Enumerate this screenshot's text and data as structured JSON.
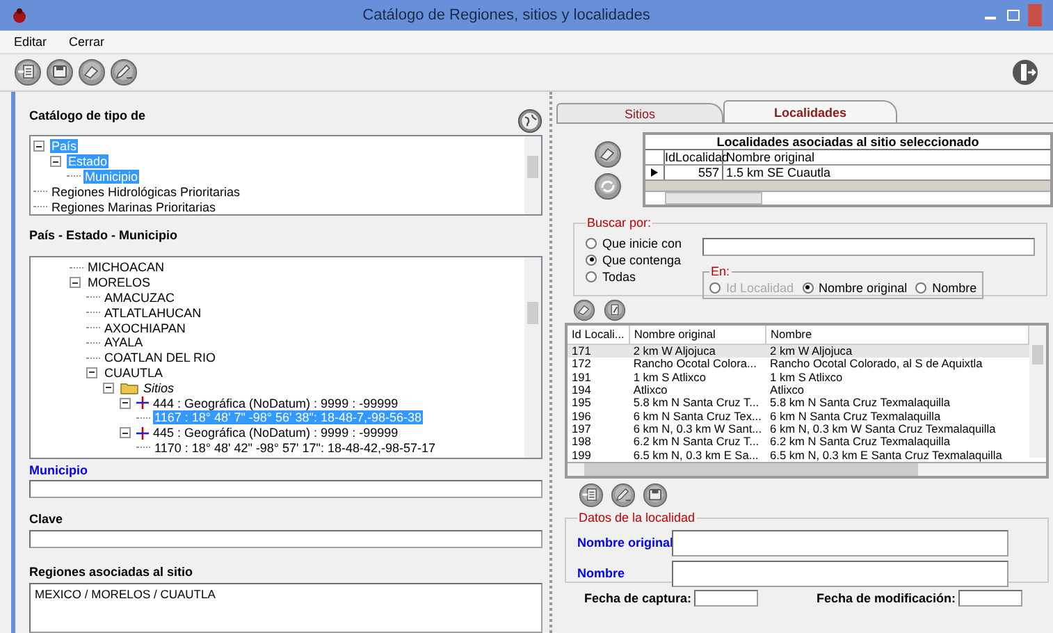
{
  "window": {
    "title": "Catálogo de Regiones, sitios y localidades"
  },
  "menu": [
    "Editar",
    "Cerrar"
  ],
  "region_types": {
    "title": "Catálogo de tipo de",
    "items": [
      {
        "label": "País",
        "selected": true,
        "expanded": true,
        "children": [
          {
            "label": "Estado",
            "selected": true,
            "expanded": true,
            "children": [
              {
                "label": "Municipio",
                "selected": true
              }
            ]
          }
        ]
      },
      {
        "label": "Regiones Hidrológicas Prioritarias",
        "selected": false
      },
      {
        "label": "Regiones Marinas Prioritarias",
        "selected": false
      }
    ]
  },
  "regions": {
    "title": "País - Estado - Municipio",
    "items": [
      {
        "label": "MICHOACAN",
        "selected": false
      },
      {
        "label": "MORELOS",
        "selected": false,
        "expanded": true,
        "children": [
          {
            "label": "AMACUZAC",
            "selected": false
          },
          {
            "label": "ATLATLAHUCAN",
            "selected": false
          },
          {
            "label": "AXOCHIAPAN",
            "selected": false
          },
          {
            "label": "AYALA",
            "selected": false
          },
          {
            "label": "COATLAN DEL RIO",
            "selected": false
          },
          {
            "label": "CUAUTLA",
            "selected": false,
            "expanded": true,
            "children": [
              {
                "label": "Sitios",
                "kind": "folder",
                "selected": false,
                "expanded": true,
                "children": [
                  {
                    "label": "444 : Geográfica (NoDatum) : 9999 : -99999",
                    "kind": "site",
                    "selected": false,
                    "expanded": true,
                    "children": [
                      {
                        "label": "1167 : 18° 48' 7\" -98° 56' 38\": 18-48-7,-98-56-38",
                        "selected": true
                      }
                    ]
                  },
                  {
                    "label": "445 : Geográfica (NoDatum) : 9999 : -99999",
                    "kind": "site",
                    "selected": false,
                    "expanded": true,
                    "children": [
                      {
                        "label": "1170 : 18° 48' 42\" -98° 57' 17\": 18-48-42,-98-57-17",
                        "selected": false
                      }
                    ]
                  }
                ]
              }
            ]
          }
        ]
      }
    ]
  },
  "municipio": {
    "label": "Municipio"
  },
  "clave": {
    "label": "Clave"
  },
  "associated_regions": {
    "label": "Regiones asociadas al sitio",
    "value": "MEXICO / MORELOS / CUAUTLA"
  },
  "tabs": [
    {
      "label": "Sitios",
      "selected": false
    },
    {
      "label": "Localidades",
      "selected": true
    }
  ],
  "linked_localities": {
    "title": "Localidades asociadas al sitio seleccionado",
    "columns": [
      "IdLocalidad",
      "Nombre original"
    ],
    "rows": [
      {
        "cells": [
          "557",
          "1.5 km SE Cuautla"
        ],
        "selected": true
      }
    ]
  },
  "search": {
    "title": "Buscar por:",
    "modes": [
      {
        "label": "Que inicie con",
        "selected": false
      },
      {
        "label": "Que contenga",
        "selected": true
      },
      {
        "label": "Todas",
        "selected": false
      }
    ],
    "in": {
      "title": "En:",
      "options": [
        {
          "label": "Id Localidad",
          "selected": false,
          "disabled": true
        },
        {
          "label": "Nombre original",
          "selected": true,
          "disabled": false
        },
        {
          "label": "Nombre",
          "selected": false,
          "disabled": false
        }
      ]
    }
  },
  "localities": {
    "columns": [
      "Id Locali...",
      "Nombre original",
      "Nombre"
    ],
    "rows": [
      {
        "cells": [
          "171",
          "2 km W Aljojuca",
          "2 km W Aljojuca"
        ],
        "selected": true
      },
      {
        "cells": [
          "172",
          "Rancho Ocotal Colora...",
          "Rancho Ocotal Colorado, al S de Aquixtla"
        ],
        "selected": false
      },
      {
        "cells": [
          "191",
          "1 km S Atlixco",
          "1 km S Atlixco"
        ],
        "selected": false
      },
      {
        "cells": [
          "194",
          "Atlixco",
          "Atlixco"
        ],
        "selected": false
      },
      {
        "cells": [
          "195",
          "5.8 km N Santa Cruz T...",
          "5.8 km N Santa Cruz Texmalaquilla"
        ],
        "selected": false
      },
      {
        "cells": [
          "196",
          "6 km N Santa Cruz Tex...",
          "6 km N Santa Cruz Texmalaquilla"
        ],
        "selected": false
      },
      {
        "cells": [
          "197",
          "6 km N, 0.3 km W Sant...",
          "6 km N, 0.3 km W Santa Cruz Texmalaquilla"
        ],
        "selected": false
      },
      {
        "cells": [
          "198",
          "6.2 km N Santa Cruz T...",
          "6.2 km N Santa Cruz Texmalaquilla"
        ],
        "selected": false
      },
      {
        "cells": [
          "199",
          "6.5 km N, 0.3 km E Sa...",
          "6.5 km N, 0.3 km E Santa Cruz Texmalaquilla"
        ],
        "selected": false
      }
    ]
  },
  "locality_data": {
    "title": "Datos de la localidad",
    "fields": [
      {
        "label": "Nombre original"
      },
      {
        "label": "Nombre"
      }
    ]
  },
  "dates": [
    {
      "label": "Fecha de captura:"
    },
    {
      "label": "Fecha de modificación:"
    }
  ]
}
